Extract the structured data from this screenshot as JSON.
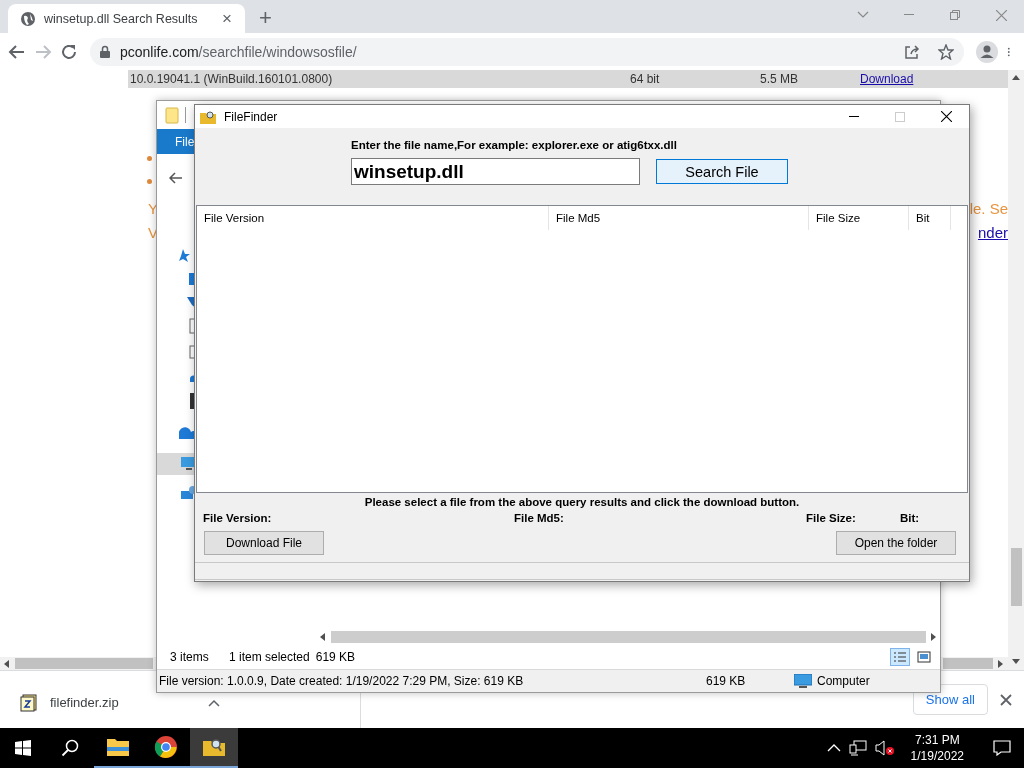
{
  "browser": {
    "tab": {
      "title": "winsetup.dll Search Results",
      "close": "×"
    },
    "new_tab": "+",
    "url": {
      "domain": "pconlife.com",
      "path": "/searchfile/windowsosfile/"
    }
  },
  "page": {
    "row": {
      "version": "10.0.19041.1 (WinBuild.160101.0800)",
      "bit": "64 bit",
      "size": "5.5 MB",
      "link": "Download"
    },
    "lines": [
      {
        "left": "Y",
        "right": "le. Se",
        "right_link": false
      },
      {
        "left": "V",
        "right": "nder",
        "right_link": true
      }
    ]
  },
  "explorer": {
    "ribbon_tab": "File",
    "status": {
      "items": "3 items",
      "selected": "1 item selected",
      "size": "619 KB"
    },
    "details": {
      "info": "File version: 1.0.0.9, Date created: 1/19/2022 7:29 PM, Size: 619 KB",
      "size": "619 KB",
      "location": "Computer"
    }
  },
  "filefinder": {
    "title": "FileFinder",
    "prompt": "Enter the file name,For example: explorer.exe or atig6txx.dll",
    "search": {
      "value": "winsetup.dll"
    },
    "search_button": "Search File",
    "columns": [
      "File Version",
      "File Md5",
      "File Size",
      "Bit"
    ],
    "message": "Please select a file from the above query results and click the download button.",
    "fields": [
      "File Version:",
      "File Md5:",
      "File Size:",
      "Bit:"
    ],
    "buttons": [
      "Download File",
      "Open the folder"
    ]
  },
  "downloads": {
    "file": "filefinder.zip",
    "show_all": "Show all"
  },
  "taskbar": {
    "apps": [
      {
        "kind": "explorer",
        "active": false
      },
      {
        "kind": "chrome",
        "active": false
      },
      {
        "kind": "filefinder",
        "active": true
      }
    ],
    "time": "7:31 PM",
    "date": "1/19/2022"
  }
}
